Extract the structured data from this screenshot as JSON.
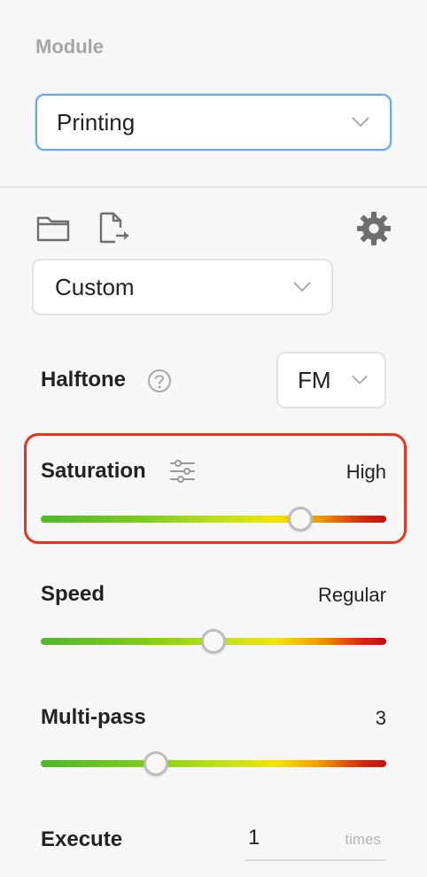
{
  "module": {
    "title": "Module",
    "selected": "Printing"
  },
  "toolbar": {
    "open_icon": "folder-icon",
    "export_icon": "export-file-icon",
    "settings_icon": "gear-icon"
  },
  "preset": {
    "selected": "Custom"
  },
  "halftone": {
    "label": "Halftone",
    "help_icon": "help-icon",
    "selected": "FM"
  },
  "saturation": {
    "label": "Saturation",
    "adjust_icon": "sliders-icon",
    "value_text": "High",
    "level": 0.75
  },
  "speed": {
    "label": "Speed",
    "value_text": "Regular",
    "level": 0.5
  },
  "multipass": {
    "label": "Multi-pass",
    "value_text": "3",
    "level": 0.333
  },
  "execute": {
    "label": "Execute",
    "value": "1",
    "unit": "times"
  },
  "colors": {
    "focus_border": "#6aa8e8",
    "highlight": "#e8331f"
  }
}
